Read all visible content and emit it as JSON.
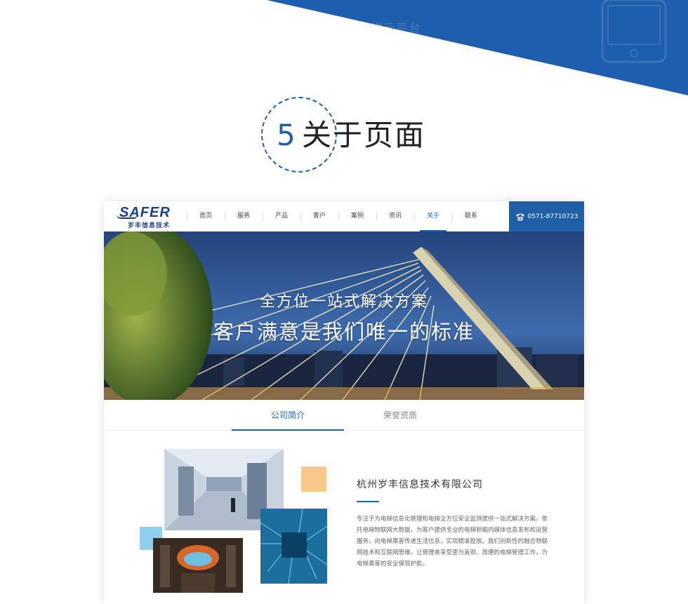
{
  "top_banner": {
    "faded_text": "电梯云平台"
  },
  "heading": {
    "number": "5",
    "title": "关于页面"
  },
  "mock_site": {
    "logo": {
      "wordmark": "SAFER",
      "subtitle": "岁丰信息技术"
    },
    "nav": [
      {
        "label": "首页",
        "active": false
      },
      {
        "label": "服务",
        "active": false
      },
      {
        "label": "产品",
        "active": false
      },
      {
        "label": "客户",
        "active": false
      },
      {
        "label": "案例",
        "active": false
      },
      {
        "label": "资讯",
        "active": false
      },
      {
        "label": "关于",
        "active": true
      },
      {
        "label": "联系",
        "active": false
      }
    ],
    "phone": "0571-87710723",
    "banner": {
      "line1": "全方位一站式解决方案",
      "line2": "客户满意是我们唯一的标准"
    },
    "tabs": [
      {
        "label": "公司简介",
        "active": true
      },
      {
        "label": "荣誉资质",
        "active": false
      }
    ],
    "about": {
      "company": "杭州岁丰信息技术有限公司",
      "body": "专注于为电梯信息化管理和电梯全方位安全监测提供一站式解决方案。依托电梯物联网大数据，为客户提供专业的电梯轿厢内媒体信息发布和运营服务，向电梯乘客传递生活信息，实现精准投放。我们创新性的融合物联网技术和互联网思维，让管理者享受更为直观、简便的电梯管理工作，为电梯乘客的安全保驾护航。"
    }
  },
  "colors": {
    "brand_blue": "#1f5fa8",
    "accent_orange": "#f8c98a",
    "accent_lightblue": "#8fd0f0"
  }
}
